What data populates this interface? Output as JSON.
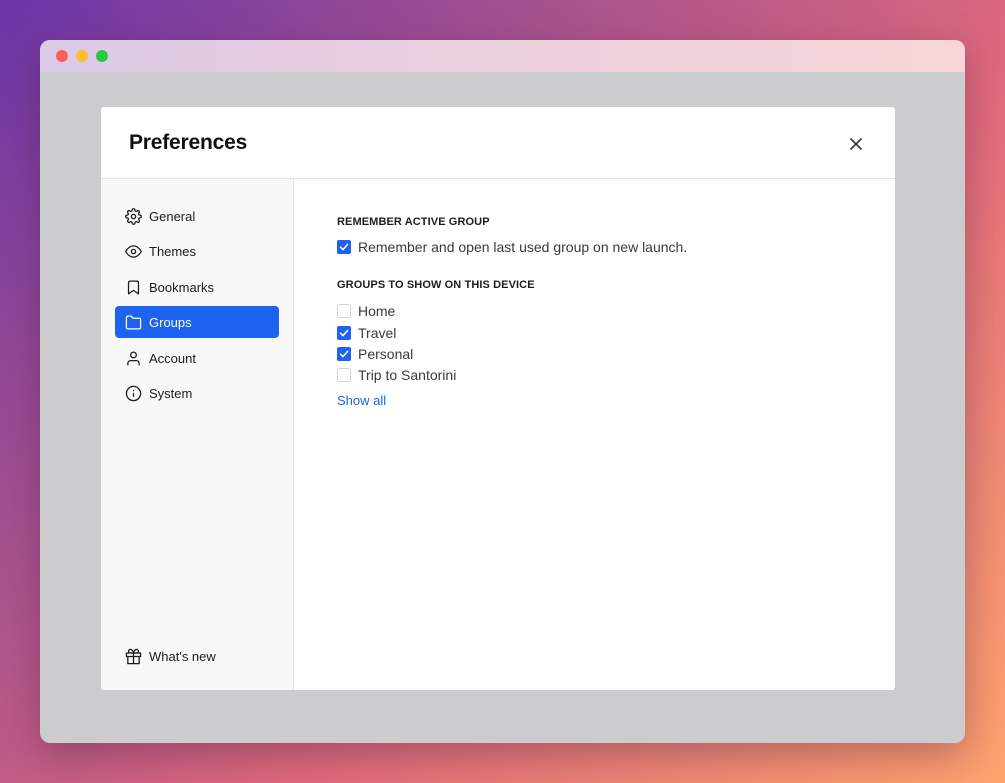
{
  "dialog": {
    "title": "Preferences"
  },
  "sidebar": {
    "items": [
      {
        "label": "General",
        "icon": "gear-icon"
      },
      {
        "label": "Themes",
        "icon": "eye-icon"
      },
      {
        "label": "Bookmarks",
        "icon": "bookmark-icon"
      },
      {
        "label": "Groups",
        "icon": "folder-icon",
        "active": true
      },
      {
        "label": "Account",
        "icon": "user-icon"
      },
      {
        "label": "System",
        "icon": "info-icon"
      }
    ],
    "footer": {
      "label": "What's new",
      "icon": "gift-icon"
    }
  },
  "content": {
    "remember": {
      "heading": "REMEMBER ACTIVE GROUP",
      "option": {
        "label": "Remember and open last used group on new launch.",
        "checked": true
      }
    },
    "groups": {
      "heading": "GROUPS TO SHOW ON THIS DEVICE",
      "items": [
        {
          "label": "Home",
          "checked": false
        },
        {
          "label": "Travel",
          "checked": true
        },
        {
          "label": "Personal",
          "checked": true
        },
        {
          "label": "Trip to Santorini",
          "checked": false
        }
      ],
      "show_all": "Show all"
    }
  },
  "colors": {
    "accent": "#1d62f0"
  }
}
